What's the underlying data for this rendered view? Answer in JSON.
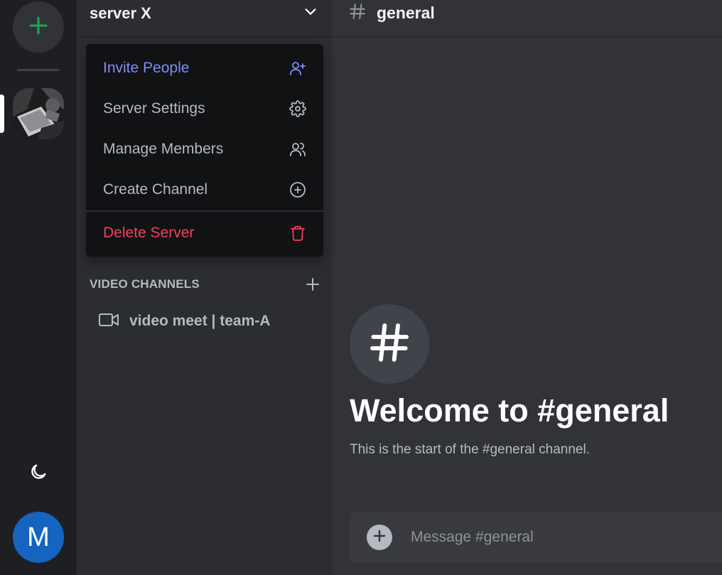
{
  "rail": {
    "add_server_icon": "plus-icon",
    "server_image": "server-photo",
    "theme_icon": "moon-icon",
    "avatar_initial": "M"
  },
  "server": {
    "name": "server X",
    "dropdown_icon": "chevron-down-icon"
  },
  "menu": {
    "items": [
      {
        "label": "Invite People",
        "icon": "user-plus-icon",
        "color": "#818cf8"
      },
      {
        "label": "Server Settings",
        "icon": "gear-icon",
        "color": "#b5bac1"
      },
      {
        "label": "Manage Members",
        "icon": "users-icon",
        "color": "#b5bac1"
      },
      {
        "label": "Create Channel",
        "icon": "plus-circle-icon",
        "color": "#b5bac1"
      },
      {
        "label": "Delete Server",
        "icon": "trash-icon",
        "color": "#f43f5e"
      }
    ]
  },
  "sections": {
    "video": {
      "title": "VIDEO CHANNELS",
      "add_icon": "plus-icon",
      "channels": [
        {
          "name": "video meet | team-A",
          "icon": "video-icon"
        }
      ]
    }
  },
  "channel_header": {
    "icon": "hash-icon",
    "title": "general"
  },
  "welcome": {
    "icon": "hash-icon",
    "title": "Welcome to #general",
    "subtitle": "This is the start of the #general channel."
  },
  "composer": {
    "placeholder": "Message #general",
    "value": ""
  },
  "colors": {
    "accent": "#818cf8",
    "danger": "#f43f5e",
    "online_green": "#23a55a",
    "avatar_bg": "#1565c0"
  }
}
